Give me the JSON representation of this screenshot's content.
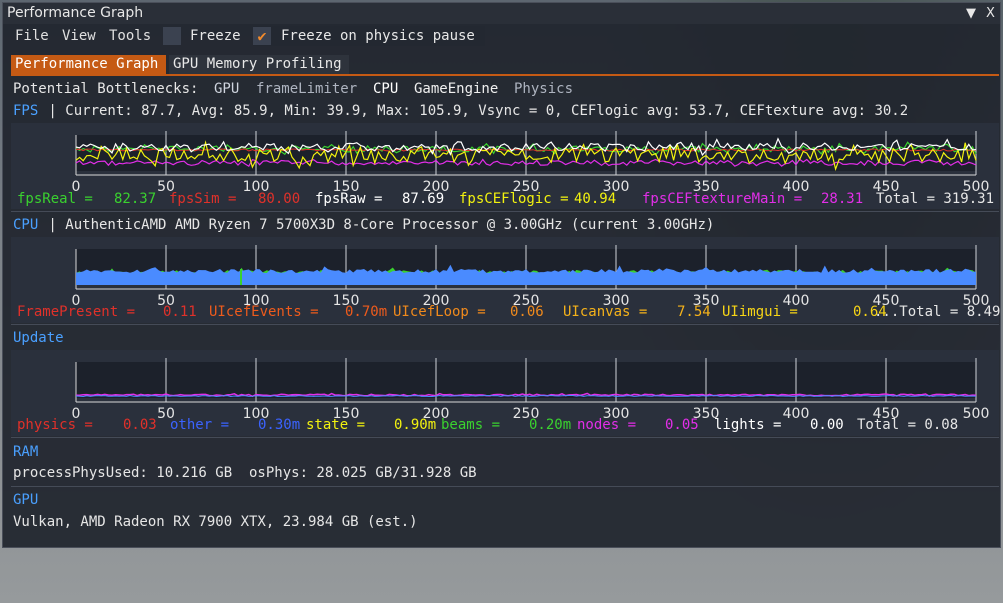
{
  "window": {
    "title": "Performance Graph",
    "controls": {
      "collapse": "▼",
      "close": "X"
    }
  },
  "menu": {
    "items": [
      "File",
      "View",
      "Tools"
    ],
    "freeze_label": "Freeze",
    "freeze_checked": false,
    "freeze_physics_label": "Freeze on physics pause",
    "freeze_physics_checked": true
  },
  "tabs": [
    {
      "label": "Performance Graph",
      "active": true
    },
    {
      "label": "GPU Memory Profiling",
      "active": false
    }
  ],
  "bottlenecks": {
    "label": "Potential Bottlenecks:",
    "items": [
      "GPU",
      "frameLimiter",
      "CPU",
      "GameEngine",
      "Physics"
    ]
  },
  "fps": {
    "header": "FPS",
    "summary": " | Current: 87.7, Avg: 85.9, Min: 39.9, Max: 105.9, Vsync = 0, CEFlogic avg: 53.7, CEFtexture avg: 30.2",
    "legend": [
      {
        "name": "fpsReal =",
        "value": "82.37",
        "color": "#3ad12f"
      },
      {
        "name": "fpsSim =",
        "value": "80.00",
        "color": "#e0312a"
      },
      {
        "name": "fpsRaw =",
        "value": "87.69",
        "color": "#ffffff"
      },
      {
        "name": "fpsCEFlogic =",
        "value": "40.94",
        "color": "#f2f20f"
      },
      {
        "name": "fpsCEFtextureMain =",
        "value": "28.31",
        "color": "#e22ee8"
      }
    ],
    "total": "Total = 319.31"
  },
  "cpu": {
    "header": "CPU",
    "summary": " | AuthenticAMD AMD Ryzen 7 5700X3D 8-Core Processor @ 3.00GHz (current 3.00GHz)",
    "legend": [
      {
        "name": "FramePresent =",
        "value": "0.11",
        "color": "#e0312a"
      },
      {
        "name": "UIcefEvents =",
        "value": "0.70m",
        "color": "#ee5b1c"
      },
      {
        "name": "UIcefLoop =",
        "value": "0.06",
        "color": "#f08a1c"
      },
      {
        "name": "UIcanvas =",
        "value": "7.54",
        "color": "#f5b21a"
      },
      {
        "name": "UIimgui =",
        "value": "0.64",
        "color": "#f7d516"
      }
    ],
    "total": "...Total = 8.49"
  },
  "update": {
    "header": "Update",
    "legend": [
      {
        "name": "physics =",
        "value": "0.03",
        "color": "#e0312a"
      },
      {
        "name": "other =",
        "value": "0.30m",
        "color": "#3b63ff"
      },
      {
        "name": "state =",
        "value": "0.90m",
        "color": "#f2f20f"
      },
      {
        "name": "beams =",
        "value": "0.20m",
        "color": "#3ad12f"
      },
      {
        "name": "nodes =",
        "value": "0.05",
        "color": "#e22ee8"
      },
      {
        "name": "lights =",
        "value": "0.00",
        "color": "#ffffff"
      }
    ],
    "total": "Total = 0.08"
  },
  "axis_ticks": [
    "0",
    "50",
    "100",
    "150",
    "200",
    "250",
    "300",
    "350",
    "400",
    "450",
    "500"
  ],
  "ram": {
    "header": "RAM",
    "line": "processPhysUsed: 10.216 GB  osPhys: 28.025 GB/31.928 GB"
  },
  "gpu": {
    "header": "GPU",
    "line": "Vulkan, AMD Radeon RX 7900 XTX, 23.984 GB (est.)"
  }
}
